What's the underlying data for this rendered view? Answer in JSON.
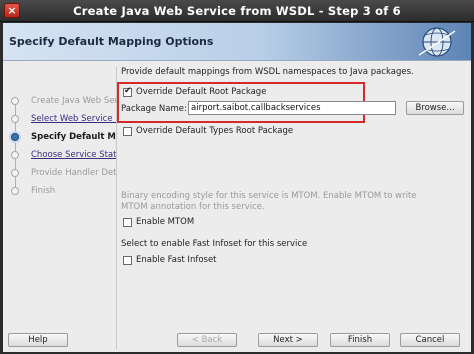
{
  "window": {
    "title": "Create Java Web Service from WSDL - Step 3 of 6",
    "close_glyph": "×"
  },
  "header": {
    "title": "Specify Default Mapping Options",
    "icon": "globe-icon"
  },
  "nav": {
    "items": [
      {
        "label": "Create Java Web Servi",
        "state": "done"
      },
      {
        "label": "Select Web Service De",
        "state": "link"
      },
      {
        "label": "Specify Default Mappi",
        "state": "current"
      },
      {
        "label": "Choose Service State",
        "state": "link"
      },
      {
        "label": "Provide Handler Detai",
        "state": "disabled"
      },
      {
        "label": "Finish",
        "state": "disabled"
      }
    ]
  },
  "content": {
    "intro": "Provide default mappings from WSDL namespaces to Java packages.",
    "override_root": {
      "label": "Override Default Root Package",
      "checked": true
    },
    "package_name": {
      "label": "Package Name:",
      "value": "airport.saibot.callbackservices"
    },
    "browse_label": "Browse...",
    "override_types": {
      "label": "Override Default Types Root Package",
      "checked": false
    },
    "mtom_note": "Binary encoding style for this service is MTOM. Enable MTOM to write MTOM annotation for this service.",
    "enable_mtom": {
      "label": "Enable MTOM",
      "checked": false
    },
    "fast_infoset_note": "Select to enable Fast Infoset for this service",
    "enable_fast_infoset": {
      "label": "Enable Fast Infoset",
      "checked": false
    }
  },
  "buttons": {
    "help": "Help",
    "back": "< Back",
    "next": "Next >",
    "finish": "Finish",
    "cancel": "Cancel"
  },
  "colors": {
    "highlight": "#d32a2a",
    "link": "#3b2a80"
  }
}
